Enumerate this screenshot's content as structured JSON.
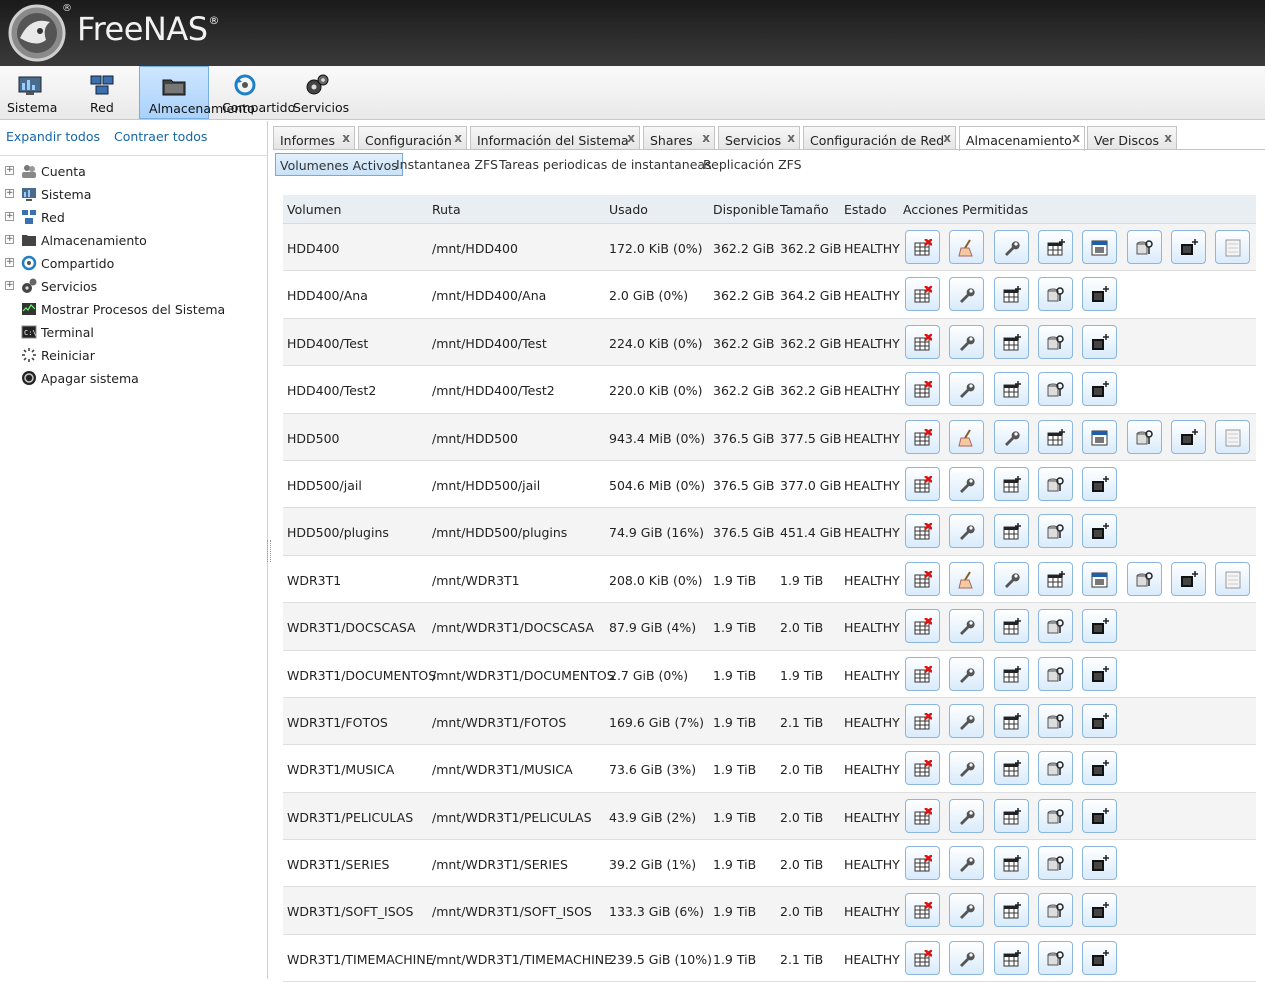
{
  "app": {
    "name": "FreeNAS",
    "reg_mark": "®"
  },
  "topnav": [
    {
      "key": "sistema",
      "label": "Sistema",
      "icon": "system-monitor-icon"
    },
    {
      "key": "red",
      "label": "Red",
      "icon": "network-icon"
    },
    {
      "key": "almacenamiento",
      "label": "Almacenamiento",
      "icon": "storage-folder-icon",
      "active": true
    },
    {
      "key": "compartido",
      "label": "Compartido",
      "icon": "sharing-icon"
    },
    {
      "key": "servicios",
      "label": "Servicios",
      "icon": "services-gear-icon"
    }
  ],
  "sidebar": {
    "expand_all": "Expandir todos",
    "collapse_all": "Contraer todos",
    "items": [
      {
        "label": "Cuenta",
        "icon": "account-icon",
        "expandable": true
      },
      {
        "label": "Sistema",
        "icon": "system-icon",
        "expandable": true
      },
      {
        "label": "Red",
        "icon": "network-icon",
        "expandable": true
      },
      {
        "label": "Almacenamiento",
        "icon": "storage-icon",
        "expandable": true
      },
      {
        "label": "Compartido",
        "icon": "sharing-icon",
        "expandable": true
      },
      {
        "label": "Servicios",
        "icon": "services-icon",
        "expandable": true
      },
      {
        "label": "Mostrar Procesos del Sistema",
        "icon": "processes-icon",
        "expandable": false
      },
      {
        "label": "Terminal",
        "icon": "terminal-icon",
        "expandable": false
      },
      {
        "label": "Reiniciar",
        "icon": "reboot-icon",
        "expandable": false
      },
      {
        "label": "Apagar sistema",
        "icon": "shutdown-icon",
        "expandable": false
      }
    ]
  },
  "tabs": [
    {
      "label": "Informes",
      "close": "x"
    },
    {
      "label": "Configuración",
      "close": "x"
    },
    {
      "label": "Información del Sistema",
      "close": "x"
    },
    {
      "label": "Shares",
      "close": "x"
    },
    {
      "label": "Servicios",
      "close": "x"
    },
    {
      "label": "Configuración de Red",
      "close": "x"
    },
    {
      "label": "Almacenamiento",
      "close": "x",
      "active": true
    },
    {
      "label": "Ver Discos",
      "close": "x"
    }
  ],
  "subtabs": [
    {
      "label": "Volumenes Activos",
      "active": true
    },
    {
      "label": "Instantanea ZFS"
    },
    {
      "label": "Tareas periodicas de instantaneas"
    },
    {
      "label": "Replicación ZFS"
    }
  ],
  "table": {
    "headers": {
      "volumen": "Volumen",
      "ruta": "Ruta",
      "usado": "Usado",
      "disponible": "Disponible",
      "tamano": "Tamaño",
      "estado": "Estado",
      "acciones": "Acciones Permitidas"
    },
    "rows": [
      {
        "volumen": "HDD400",
        "ruta": "/mnt/HDD400",
        "usado": "172.0 KiB (0%)",
        "disponible": "362.2 GiB",
        "tamano": "362.2 GiB",
        "estado": "HEALTHY",
        "pool": true
      },
      {
        "volumen": "HDD400/Ana",
        "ruta": "/mnt/HDD400/Ana",
        "usado": "2.0 GiB (0%)",
        "disponible": "362.2 GiB",
        "tamano": "364.2 GiB",
        "estado": "HEALTHY",
        "pool": false
      },
      {
        "volumen": "HDD400/Test",
        "ruta": "/mnt/HDD400/Test",
        "usado": "224.0 KiB (0%)",
        "disponible": "362.2 GiB",
        "tamano": "362.2 GiB",
        "estado": "HEALTHY",
        "pool": false
      },
      {
        "volumen": "HDD400/Test2",
        "ruta": "/mnt/HDD400/Test2",
        "usado": "220.0 KiB (0%)",
        "disponible": "362.2 GiB",
        "tamano": "362.2 GiB",
        "estado": "HEALTHY",
        "pool": false
      },
      {
        "volumen": "HDD500",
        "ruta": "/mnt/HDD500",
        "usado": "943.4 MiB (0%)",
        "disponible": "376.5 GiB",
        "tamano": "377.5 GiB",
        "estado": "HEALTHY",
        "pool": true
      },
      {
        "volumen": "HDD500/jail",
        "ruta": "/mnt/HDD500/jail",
        "usado": "504.6 MiB (0%)",
        "disponible": "376.5 GiB",
        "tamano": "377.0 GiB",
        "estado": "HEALTHY",
        "pool": false
      },
      {
        "volumen": "HDD500/plugins",
        "ruta": "/mnt/HDD500/plugins",
        "usado": "74.9 GiB (16%)",
        "disponible": "376.5 GiB",
        "tamano": "451.4 GiB",
        "estado": "HEALTHY",
        "pool": false
      },
      {
        "volumen": "WDR3T1",
        "ruta": "/mnt/WDR3T1",
        "usado": "208.0 KiB (0%)",
        "disponible": "1.9 TiB",
        "tamano": "1.9 TiB",
        "estado": "HEALTHY",
        "pool": true
      },
      {
        "volumen": "WDR3T1/DOCSCASA",
        "ruta": "/mnt/WDR3T1/DOCSCASA",
        "usado": "87.9 GiB (4%)",
        "disponible": "1.9 TiB",
        "tamano": "2.0 TiB",
        "estado": "HEALTHY",
        "pool": false
      },
      {
        "volumen": "WDR3T1/DOCUMENTOS",
        "ruta": "/mnt/WDR3T1/DOCUMENTOS",
        "usado": "2.7 GiB (0%)",
        "disponible": "1.9 TiB",
        "tamano": "1.9 TiB",
        "estado": "HEALTHY",
        "pool": false
      },
      {
        "volumen": "WDR3T1/FOTOS",
        "ruta": "/mnt/WDR3T1/FOTOS",
        "usado": "169.6 GiB (7%)",
        "disponible": "1.9 TiB",
        "tamano": "2.1 TiB",
        "estado": "HEALTHY",
        "pool": false
      },
      {
        "volumen": "WDR3T1/MUSICA",
        "ruta": "/mnt/WDR3T1/MUSICA",
        "usado": "73.6 GiB (3%)",
        "disponible": "1.9 TiB",
        "tamano": "2.0 TiB",
        "estado": "HEALTHY",
        "pool": false
      },
      {
        "volumen": "WDR3T1/PELICULAS",
        "ruta": "/mnt/WDR3T1/PELICULAS",
        "usado": "43.9 GiB (2%)",
        "disponible": "1.9 TiB",
        "tamano": "2.0 TiB",
        "estado": "HEALTHY",
        "pool": false
      },
      {
        "volumen": "WDR3T1/SERIES",
        "ruta": "/mnt/WDR3T1/SERIES",
        "usado": "39.2 GiB (1%)",
        "disponible": "1.9 TiB",
        "tamano": "2.0 TiB",
        "estado": "HEALTHY",
        "pool": false
      },
      {
        "volumen": "WDR3T1/SOFT_ISOS",
        "ruta": "/mnt/WDR3T1/SOFT_ISOS",
        "usado": "133.3 GiB (6%)",
        "disponible": "1.9 TiB",
        "tamano": "2.0 TiB",
        "estado": "HEALTHY",
        "pool": false
      },
      {
        "volumen": "WDR3T1/TIMEMACHINE",
        "ruta": "/mnt/WDR3T1/TIMEMACHINE",
        "usado": "239.5 GiB (10%)",
        "disponible": "1.9 TiB",
        "tamano": "2.1 TiB",
        "estado": "HEALTHY",
        "pool": false
      }
    ],
    "pool_actions": [
      "detach-volume-icon",
      "scrub-volume-icon",
      "edit-permissions-icon",
      "create-dataset-icon",
      "create-zvol-icon",
      "change-passphrase-icon",
      "create-snapshot-icon",
      "volume-status-icon"
    ],
    "dataset_actions": [
      "destroy-dataset-icon",
      "edit-permissions-icon",
      "create-dataset-icon",
      "dataset-options-icon",
      "create-snapshot-icon"
    ]
  }
}
